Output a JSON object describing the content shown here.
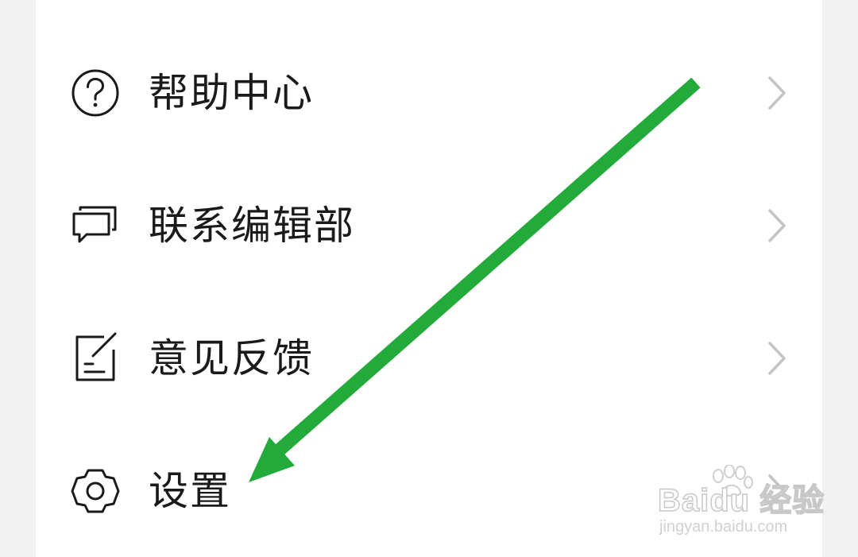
{
  "menu": {
    "items": [
      {
        "label": "帮助中心",
        "icon": "help-circle-icon"
      },
      {
        "label": "联系编辑部",
        "icon": "chat-bubbles-icon"
      },
      {
        "label": "意见反馈",
        "icon": "feedback-edit-icon"
      },
      {
        "label": "设置",
        "icon": "gear-icon"
      }
    ]
  },
  "annotation": {
    "arrow_color": "#22aa3a"
  },
  "watermark": {
    "brand": "Baidu 经验",
    "url": "jingyan.baidu.com"
  }
}
